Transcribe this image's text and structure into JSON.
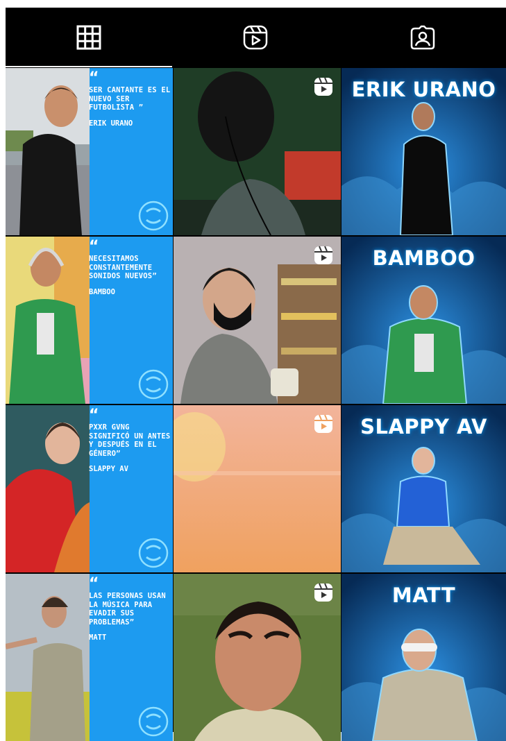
{
  "tabs": [
    {
      "name": "grid",
      "icon": "grid-icon",
      "active": true
    },
    {
      "name": "reels",
      "icon": "reels-icon",
      "active": false
    },
    {
      "name": "tagged",
      "icon": "tagged-person-icon",
      "active": false
    }
  ],
  "posts": [
    {
      "type": "quote",
      "text": "SER CANTANTE ES EL NUEVO SER FUTBOLISTA",
      "closing": "”",
      "author": "ERIK URANO"
    },
    {
      "type": "reel"
    },
    {
      "type": "artist",
      "name": "ERIK URANO"
    },
    {
      "type": "quote",
      "text": "NECESITAMOS CONSTANTEMENTE SONIDOS NUEVOS",
      "closing": "”",
      "author": "BAMBOO"
    },
    {
      "type": "reel"
    },
    {
      "type": "artist",
      "name": "BAMBOO"
    },
    {
      "type": "quote",
      "text": "PXXR GVNG SIGNIFICÓ UN ANTES Y DESPUÉS EN EL GÉNERO",
      "closing": "”",
      "author": "SLAPPY AV"
    },
    {
      "type": "reel"
    },
    {
      "type": "artist",
      "name": "SLAPPY AV"
    },
    {
      "type": "quote",
      "text": "LAS PERSONAS USAN LA MÚSICA PARA EVADIR SUS PROBLEMAS",
      "closing": "”",
      "author": "MATT"
    },
    {
      "type": "reel"
    },
    {
      "type": "artist",
      "name": "MATT"
    }
  ],
  "colors": {
    "quote_bg": "#1d9bf0",
    "artist_bg": "#0a3f73",
    "glow": "#37b5ff"
  }
}
